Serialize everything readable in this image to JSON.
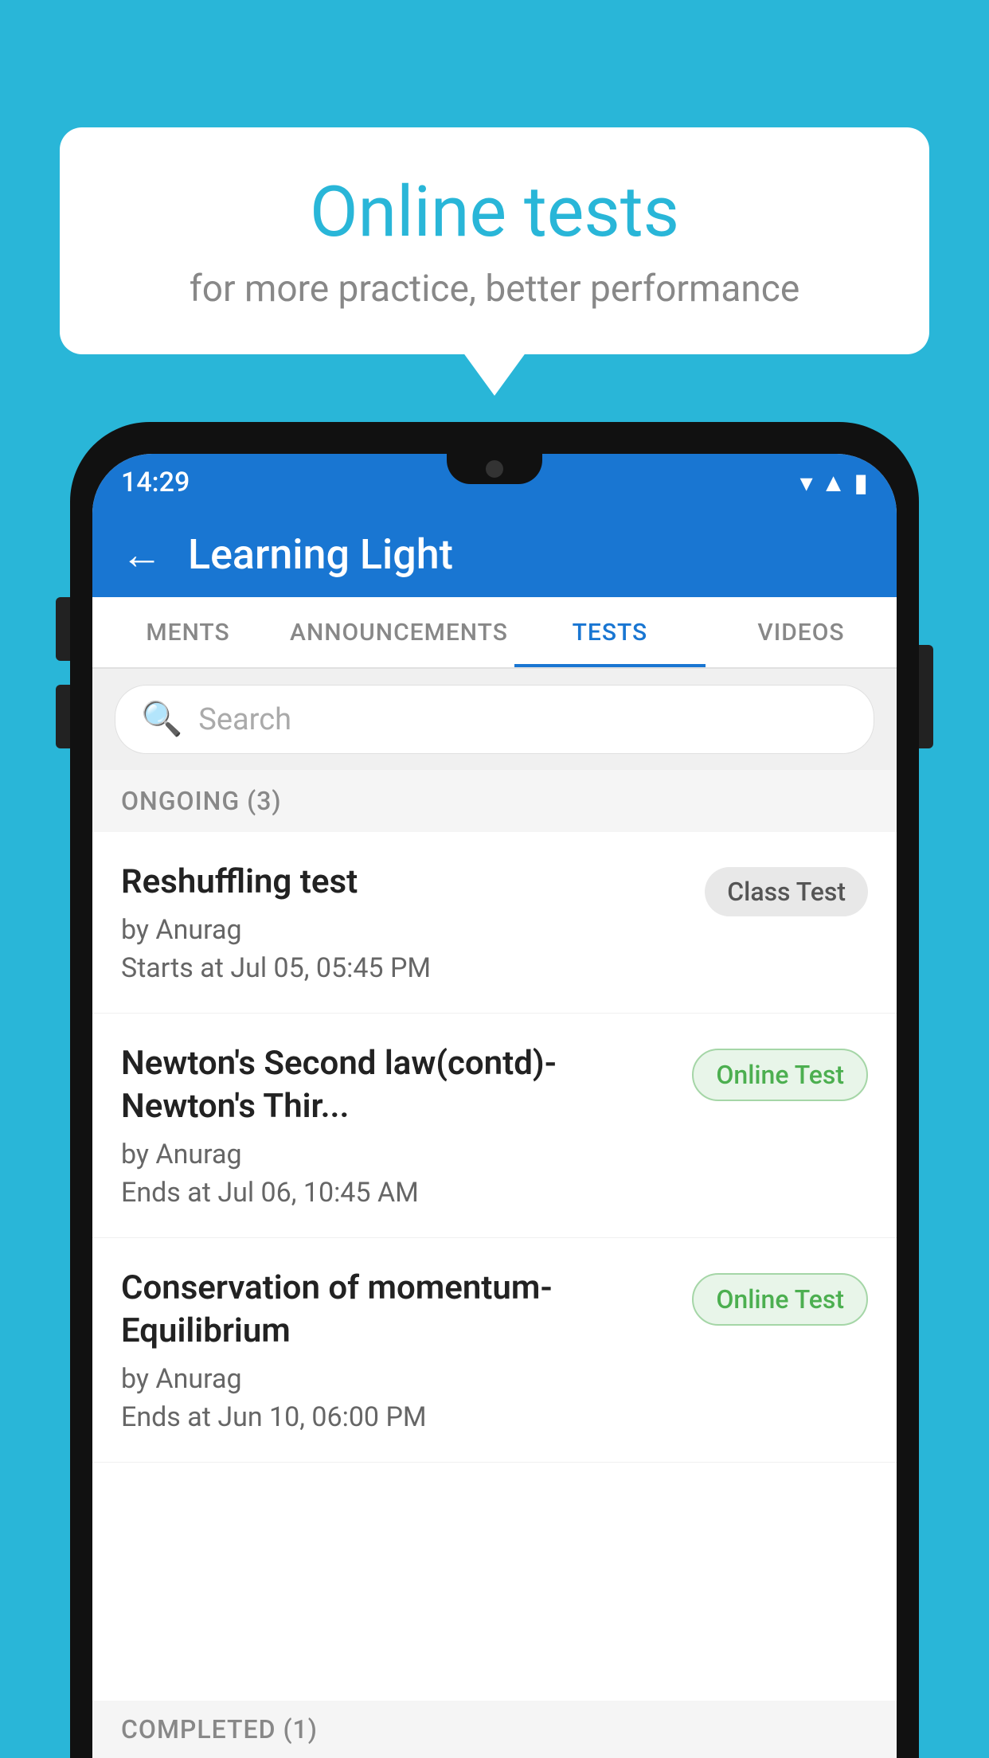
{
  "background": {
    "color": "#29b6d8"
  },
  "bubble": {
    "title": "Online tests",
    "subtitle": "for more practice, better performance"
  },
  "phone": {
    "statusBar": {
      "time": "14:29",
      "icons": [
        "wifi",
        "signal",
        "battery"
      ]
    },
    "header": {
      "backLabel": "←",
      "title": "Learning Light"
    },
    "tabs": [
      {
        "label": "MENTS",
        "active": false
      },
      {
        "label": "ANNOUNCEMENTS",
        "active": false
      },
      {
        "label": "TESTS",
        "active": true
      },
      {
        "label": "VIDEOS",
        "active": false
      }
    ],
    "search": {
      "placeholder": "Search"
    },
    "ongoingSection": {
      "label": "ONGOING (3)"
    },
    "tests": [
      {
        "name": "Reshuffling test",
        "author": "by Anurag",
        "timeLabel": "Starts at",
        "time": "Jul 05, 05:45 PM",
        "badgeText": "Class Test",
        "badgeType": "class"
      },
      {
        "name": "Newton's Second law(contd)-Newton's Thir...",
        "author": "by Anurag",
        "timeLabel": "Ends at",
        "time": "Jul 06, 10:45 AM",
        "badgeText": "Online Test",
        "badgeType": "online"
      },
      {
        "name": "Conservation of momentum-Equilibrium",
        "author": "by Anurag",
        "timeLabel": "Ends at",
        "time": "Jun 10, 06:00 PM",
        "badgeText": "Online Test",
        "badgeType": "online"
      }
    ],
    "completedSection": {
      "label": "COMPLETED (1)"
    }
  }
}
